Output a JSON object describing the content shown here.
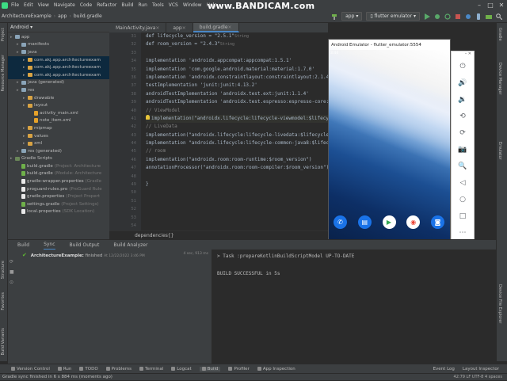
{
  "watermark": "www.BANDICAM.com",
  "menu": [
    "File",
    "Edit",
    "View",
    "Navigate",
    "Code",
    "Refactor",
    "Build",
    "Run",
    "Tools",
    "VCS",
    "Window",
    "Help"
  ],
  "breadcrumbs": [
    "ArchitectureExample",
    "app",
    "build.gradle"
  ],
  "run_config": {
    "module": "app",
    "device": "flutter emulator"
  },
  "left_strip": {
    "project": "Project",
    "resource_manager": "Resource Manager",
    "structure": "Structure",
    "favorites": "Favorites",
    "build_variants": "Build Variants"
  },
  "right_strip": {
    "gradle": "Gradle",
    "device_manager": "Device Manager",
    "emulator": "Emulator",
    "device_file_explorer": "Device File Explorer"
  },
  "project_panel": {
    "view": "Android",
    "items": [
      {
        "label": "app",
        "depth": 0,
        "kind": "folder",
        "selected": false
      },
      {
        "label": "manifests",
        "depth": 1,
        "kind": "folder",
        "selected": false
      },
      {
        "label": "java",
        "depth": 1,
        "kind": "folder",
        "selected": false
      },
      {
        "label": "com.akj.app.architectureexam",
        "depth": 2,
        "kind": "folder",
        "selected": true
      },
      {
        "label": "com.akj.app.architectureexam",
        "depth": 2,
        "kind": "folder",
        "selected": true
      },
      {
        "label": "com.akj.app.architectureexam",
        "depth": 2,
        "kind": "folder",
        "selected": true
      },
      {
        "label": "java (generated)",
        "depth": 1,
        "kind": "folder",
        "selected": false
      },
      {
        "label": "res",
        "depth": 1,
        "kind": "folder",
        "selected": false
      },
      {
        "label": "drawable",
        "depth": 2,
        "kind": "folder",
        "selected": false
      },
      {
        "label": "layout",
        "depth": 2,
        "kind": "folder",
        "selected": false
      },
      {
        "label": "activity_main.xml",
        "depth": 3,
        "kind": "xml",
        "selected": false
      },
      {
        "label": "note_item.xml",
        "depth": 3,
        "kind": "xml",
        "selected": false
      },
      {
        "label": "mipmap",
        "depth": 2,
        "kind": "folder",
        "selected": false
      },
      {
        "label": "values",
        "depth": 2,
        "kind": "folder",
        "selected": false
      },
      {
        "label": "xml",
        "depth": 2,
        "kind": "folder",
        "selected": false
      },
      {
        "label": "res (generated)",
        "depth": 1,
        "kind": "folder",
        "selected": false
      },
      {
        "label": "Gradle Scripts",
        "depth": 0,
        "kind": "gradle-folder",
        "selected": false
      },
      {
        "label": "build.gradle",
        "note": "(Project: Architecture",
        "depth": 1,
        "kind": "gradle",
        "selected": false
      },
      {
        "label": "build.gradle",
        "note": "(Module: Architecture",
        "depth": 1,
        "kind": "gradle",
        "selected": false
      },
      {
        "label": "gradle-wrapper.properties",
        "note": "(Gradle",
        "depth": 1,
        "kind": "file",
        "selected": false
      },
      {
        "label": "proguard-rules.pro",
        "note": "(ProGuard Rule",
        "depth": 1,
        "kind": "file",
        "selected": false
      },
      {
        "label": "gradle.properties",
        "note": "(Project Propert",
        "depth": 1,
        "kind": "file",
        "selected": false
      },
      {
        "label": "settings.gradle",
        "note": "(Project Settings)",
        "depth": 1,
        "kind": "gradle",
        "selected": false
      },
      {
        "label": "local.properties",
        "note": "(SDK Location)",
        "depth": 1,
        "kind": "file",
        "selected": false
      }
    ]
  },
  "editor_tabs": [
    {
      "label": "MainActivity.java",
      "active": false
    },
    {
      "label": "app",
      "active": false
    },
    {
      "label": "build.gradle",
      "active": true
    }
  ],
  "line_numbers": [
    "31",
    "32",
    "33",
    "34",
    "35",
    "36",
    "37",
    "38",
    "39",
    "40",
    "41",
    "42",
    "43",
    "44",
    "45",
    "46",
    "47",
    "48",
    "49",
    "50",
    "51",
    "52",
    "53",
    "54"
  ],
  "code_lines": [
    {
      "text": "def lifecycle_version = \"2.5.1\"",
      "hint": "String"
    },
    {
      "text": "def room_version = \"2.4.3\"",
      "hint": "String"
    },
    {
      "text": ""
    },
    {
      "text": "implementation 'androidx.appcompat:appcompat:1.5.1'"
    },
    {
      "text": "implementation 'com.google.android.material:material:1.7.0'"
    },
    {
      "text": "implementation 'androidx.constraintlayout:constraintlayout:2.1.4'"
    },
    {
      "text": "testImplementation 'junit:junit:4.13.2'"
    },
    {
      "text": "androidTestImplementation 'androidx.test.ext:junit:1.1.4'"
    },
    {
      "text": "androidTestImplementation 'androidx.test.espresso:espresso-core:3.5.0'"
    },
    {
      "text": "// ViewModel"
    },
    {
      "text": "implementation(\"androidx.lifecycle:lifecycle-viewmodel:$lifecycle_version\")"
    },
    {
      "text": "// LiveData"
    },
    {
      "text": "implementation(\"androidx.lifecycle:lifecycle-livedata:$lifecycle_version\")"
    },
    {
      "text": "implementation \"androidx.lifecycle:lifecycle-common-java8:$lifecycle_version\""
    },
    {
      "text": "// room"
    },
    {
      "text": "implementation(\"androidx.room:room-runtime:$room_version\")"
    },
    {
      "text": "annotationProcessor(\"androidx.room:room-compiler:$room_version\")"
    },
    {
      "text": ""
    },
    {
      "text": "}"
    }
  ],
  "editor_breadcrumb": "dependencies{}",
  "emulator": {
    "title": "Android Emulator - flutter_emulator:5554",
    "status_time": "3:44",
    "dock_apps": [
      {
        "name": "phone",
        "glyph": "✆",
        "color": "#1a73e8"
      },
      {
        "name": "messages",
        "glyph": "▤",
        "color": "#1a73e8"
      },
      {
        "name": "play-store",
        "glyph": "▶",
        "color": "#ffffff"
      },
      {
        "name": "chrome",
        "glyph": "◉",
        "color": "#ea4335"
      },
      {
        "name": "camera",
        "glyph": "◙",
        "color": "#1a73e8"
      }
    ],
    "tool_icons": [
      {
        "name": "power-icon",
        "glyph": "⏻"
      },
      {
        "name": "volume-up-icon",
        "glyph": "🔊"
      },
      {
        "name": "volume-down-icon",
        "glyph": "🔉"
      },
      {
        "name": "rotate-left-icon",
        "glyph": "⟲"
      },
      {
        "name": "rotate-right-icon",
        "glyph": "⟳"
      },
      {
        "name": "screenshot-icon",
        "glyph": "📷"
      },
      {
        "name": "zoom-icon",
        "glyph": "🔍"
      },
      {
        "name": "back-icon",
        "glyph": "◁"
      },
      {
        "name": "home-icon",
        "glyph": "○"
      },
      {
        "name": "overview-icon",
        "glyph": "□"
      },
      {
        "name": "more-icon",
        "glyph": "⋯"
      }
    ]
  },
  "bottom_tabs": [
    {
      "label": "Build",
      "active": false
    },
    {
      "label": "Sync",
      "active": true
    },
    {
      "label": "Build Output",
      "active": false
    },
    {
      "label": "Build Analyzer",
      "active": false
    }
  ],
  "build_tree": {
    "label": "ArchitectureExample:",
    "status": "finished",
    "time": "At 12/22/2022 3:46 PM",
    "duration": "4 sec, 913 ms"
  },
  "build_output": [
    "> Task :prepareKotlinBuildScriptModel UP-TO-DATE",
    "",
    "BUILD SUCCESSFUL in 5s"
  ],
  "tool_windows": [
    {
      "label": "Version Control",
      "active": false
    },
    {
      "label": "Run",
      "active": false
    },
    {
      "label": "TODO",
      "active": false
    },
    {
      "label": "Problems",
      "active": false
    },
    {
      "label": "Terminal",
      "active": false
    },
    {
      "label": "Logcat",
      "active": false
    },
    {
      "label": "Build",
      "active": true
    },
    {
      "label": "Profiler",
      "active": false
    },
    {
      "label": "App Inspection",
      "active": false
    }
  ],
  "tool_windows_right": [
    "Event Log",
    "Layout Inspector"
  ],
  "status": {
    "message": "Gradle sync finished in 6 s 884 ms (moments ago)",
    "right": "42:79  LF  UTF-8  4 spaces"
  }
}
